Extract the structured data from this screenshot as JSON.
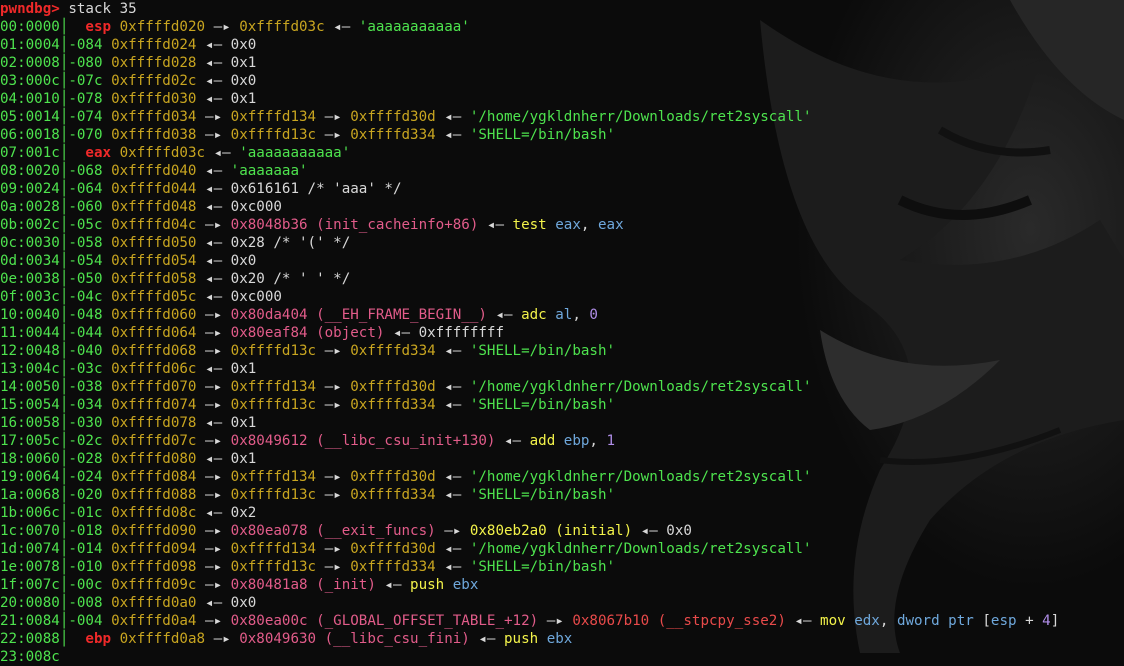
{
  "prompt": {
    "name": "pwndbg>",
    "command": " stack 35"
  },
  "colors": {
    "background": "#0b0b0b",
    "register": "#ef2929",
    "offset": "#4ee34e",
    "stack_address": "#c8a520",
    "code_address": "#e25c8a",
    "instruction": "#f3f34a",
    "operand": "#6fa8dc",
    "number": "#b08ee8"
  },
  "arrows": {
    "right": "—▸",
    "left": "◂—"
  },
  "rows": [
    {
      "idx": "00:0000",
      "reg": "esp",
      "off": "",
      "addr": "0xffffd020",
      "tail": [
        {
          "t": "ra",
          "v": "0xffffd03c",
          "c": "olive"
        },
        {
          "t": "la",
          "v": "'aaaaaaaaaaa'",
          "c": "green"
        }
      ]
    },
    {
      "idx": "01:0004",
      "reg": "",
      "off": "-084",
      "addr": "0xffffd024",
      "tail": [
        {
          "t": "la",
          "v": "0x0",
          "c": "white"
        }
      ]
    },
    {
      "idx": "02:0008",
      "reg": "",
      "off": "-080",
      "addr": "0xffffd028",
      "tail": [
        {
          "t": "la",
          "v": "0x1",
          "c": "white"
        }
      ]
    },
    {
      "idx": "03:000c",
      "reg": "",
      "off": "-07c",
      "addr": "0xffffd02c",
      "tail": [
        {
          "t": "la",
          "v": "0x0",
          "c": "white"
        }
      ]
    },
    {
      "idx": "04:0010",
      "reg": "",
      "off": "-078",
      "addr": "0xffffd030",
      "tail": [
        {
          "t": "la",
          "v": "0x1",
          "c": "white"
        }
      ]
    },
    {
      "idx": "05:0014",
      "reg": "",
      "off": "-074",
      "addr": "0xffffd034",
      "tail": [
        {
          "t": "ra",
          "v": "0xffffd134",
          "c": "olive"
        },
        {
          "t": "ra",
          "v": "0xffffd30d",
          "c": "olive"
        },
        {
          "t": "la",
          "v": "'/home/ygkldnherr/Downloads/ret2syscall'",
          "c": "green"
        }
      ]
    },
    {
      "idx": "06:0018",
      "reg": "",
      "off": "-070",
      "addr": "0xffffd038",
      "tail": [
        {
          "t": "ra",
          "v": "0xffffd13c",
          "c": "olive"
        },
        {
          "t": "ra",
          "v": "0xffffd334",
          "c": "olive"
        },
        {
          "t": "la",
          "v": "'SHELL=/bin/bash'",
          "c": "green"
        }
      ]
    },
    {
      "idx": "07:001c",
      "reg": "eax",
      "off": "",
      "addr": "0xffffd03c",
      "tail": [
        {
          "t": "la",
          "v": "'aaaaaaaaaaa'",
          "c": "green"
        }
      ]
    },
    {
      "idx": "08:0020",
      "reg": "",
      "off": "-068",
      "addr": "0xffffd040",
      "tail": [
        {
          "t": "la",
          "v": "'aaaaaaa'",
          "c": "green"
        }
      ]
    },
    {
      "idx": "09:0024",
      "reg": "",
      "off": "-064",
      "addr": "0xffffd044",
      "tail": [
        {
          "t": "la",
          "v": "0x616161 /* 'aaa' */",
          "c": "white"
        }
      ]
    },
    {
      "idx": "0a:0028",
      "reg": "",
      "off": "-060",
      "addr": "0xffffd048",
      "tail": [
        {
          "t": "la",
          "v": "0xc000",
          "c": "white"
        }
      ]
    },
    {
      "idx": "0b:002c",
      "reg": "",
      "off": "-05c",
      "addr": "0xffffd04c",
      "tail": [
        {
          "t": "ra",
          "v": "0x8048b36 (init_cacheinfo+86)",
          "c": "pink"
        },
        {
          "t": "la",
          "v": "",
          "c": "white",
          "asm": [
            [
              "test",
              "yellow"
            ],
            [
              " eax",
              "cyan"
            ],
            [
              ", ",
              "white"
            ],
            [
              "eax",
              "cyan"
            ]
          ]
        }
      ]
    },
    {
      "idx": "0c:0030",
      "reg": "",
      "off": "-058",
      "addr": "0xffffd050",
      "tail": [
        {
          "t": "la",
          "v": "0x28 /* '(' */",
          "c": "white"
        }
      ]
    },
    {
      "idx": "0d:0034",
      "reg": "",
      "off": "-054",
      "addr": "0xffffd054",
      "tail": [
        {
          "t": "la",
          "v": "0x0",
          "c": "white"
        }
      ]
    },
    {
      "idx": "0e:0038",
      "reg": "",
      "off": "-050",
      "addr": "0xffffd058",
      "tail": [
        {
          "t": "la",
          "v": "0x20 /* ' ' */",
          "c": "white"
        }
      ]
    },
    {
      "idx": "0f:003c",
      "reg": "",
      "off": "-04c",
      "addr": "0xffffd05c",
      "tail": [
        {
          "t": "la",
          "v": "0xc000",
          "c": "white"
        }
      ]
    },
    {
      "idx": "10:0040",
      "reg": "",
      "off": "-048",
      "addr": "0xffffd060",
      "tail": [
        {
          "t": "ra",
          "v": "0x80da404 (__EH_FRAME_BEGIN__)",
          "c": "pink"
        },
        {
          "t": "la",
          "v": "",
          "c": "white",
          "asm": [
            [
              "adc",
              "yellow"
            ],
            [
              " al",
              "cyan"
            ],
            [
              ", ",
              "white"
            ],
            [
              "0",
              "purple"
            ]
          ]
        }
      ]
    },
    {
      "idx": "11:0044",
      "reg": "",
      "off": "-044",
      "addr": "0xffffd064",
      "tail": [
        {
          "t": "ra",
          "v": "0x80eaf84 (object)",
          "c": "pink"
        },
        {
          "t": "la",
          "v": "0xffffffff",
          "c": "white"
        }
      ]
    },
    {
      "idx": "12:0048",
      "reg": "",
      "off": "-040",
      "addr": "0xffffd068",
      "tail": [
        {
          "t": "ra",
          "v": "0xffffd13c",
          "c": "olive"
        },
        {
          "t": "ra",
          "v": "0xffffd334",
          "c": "olive"
        },
        {
          "t": "la",
          "v": "'SHELL=/bin/bash'",
          "c": "green"
        }
      ]
    },
    {
      "idx": "13:004c",
      "reg": "",
      "off": "-03c",
      "addr": "0xffffd06c",
      "tail": [
        {
          "t": "la",
          "v": "0x1",
          "c": "white"
        }
      ]
    },
    {
      "idx": "14:0050",
      "reg": "",
      "off": "-038",
      "addr": "0xffffd070",
      "tail": [
        {
          "t": "ra",
          "v": "0xffffd134",
          "c": "olive"
        },
        {
          "t": "ra",
          "v": "0xffffd30d",
          "c": "olive"
        },
        {
          "t": "la",
          "v": "'/home/ygkldnherr/Downloads/ret2syscall'",
          "c": "green"
        }
      ]
    },
    {
      "idx": "15:0054",
      "reg": "",
      "off": "-034",
      "addr": "0xffffd074",
      "tail": [
        {
          "t": "ra",
          "v": "0xffffd13c",
          "c": "olive"
        },
        {
          "t": "ra",
          "v": "0xffffd334",
          "c": "olive"
        },
        {
          "t": "la",
          "v": "'SHELL=/bin/bash'",
          "c": "green"
        }
      ]
    },
    {
      "idx": "16:0058",
      "reg": "",
      "off": "-030",
      "addr": "0xffffd078",
      "tail": [
        {
          "t": "la",
          "v": "0x1",
          "c": "white"
        }
      ]
    },
    {
      "idx": "17:005c",
      "reg": "",
      "off": "-02c",
      "addr": "0xffffd07c",
      "tail": [
        {
          "t": "ra",
          "v": "0x8049612 (__libc_csu_init+130)",
          "c": "pink"
        },
        {
          "t": "la",
          "v": "",
          "c": "white",
          "asm": [
            [
              "add",
              "yellow"
            ],
            [
              " ebp",
              "cyan"
            ],
            [
              ", ",
              "white"
            ],
            [
              "1",
              "purple"
            ]
          ]
        }
      ]
    },
    {
      "idx": "18:0060",
      "reg": "",
      "off": "-028",
      "addr": "0xffffd080",
      "tail": [
        {
          "t": "la",
          "v": "0x1",
          "c": "white"
        }
      ]
    },
    {
      "idx": "19:0064",
      "reg": "",
      "off": "-024",
      "addr": "0xffffd084",
      "tail": [
        {
          "t": "ra",
          "v": "0xffffd134",
          "c": "olive"
        },
        {
          "t": "ra",
          "v": "0xffffd30d",
          "c": "olive"
        },
        {
          "t": "la",
          "v": "'/home/ygkldnherr/Downloads/ret2syscall'",
          "c": "green"
        }
      ]
    },
    {
      "idx": "1a:0068",
      "reg": "",
      "off": "-020",
      "addr": "0xffffd088",
      "tail": [
        {
          "t": "ra",
          "v": "0xffffd13c",
          "c": "olive"
        },
        {
          "t": "ra",
          "v": "0xffffd334",
          "c": "olive"
        },
        {
          "t": "la",
          "v": "'SHELL=/bin/bash'",
          "c": "green"
        }
      ]
    },
    {
      "idx": "1b:006c",
      "reg": "",
      "off": "-01c",
      "addr": "0xffffd08c",
      "tail": [
        {
          "t": "la",
          "v": "0x2",
          "c": "white"
        }
      ]
    },
    {
      "idx": "1c:0070",
      "reg": "",
      "off": "-018",
      "addr": "0xffffd090",
      "tail": [
        {
          "t": "ra",
          "v": "0x80ea078 (__exit_funcs)",
          "c": "pink"
        },
        {
          "t": "ra",
          "v": "0x80eb2a0 (initial)",
          "c": "yellow"
        },
        {
          "t": "la",
          "v": "0x0",
          "c": "white"
        }
      ]
    },
    {
      "idx": "1d:0074",
      "reg": "",
      "off": "-014",
      "addr": "0xffffd094",
      "tail": [
        {
          "t": "ra",
          "v": "0xffffd134",
          "c": "olive"
        },
        {
          "t": "ra",
          "v": "0xffffd30d",
          "c": "olive"
        },
        {
          "t": "la",
          "v": "'/home/ygkldnherr/Downloads/ret2syscall'",
          "c": "green"
        }
      ]
    },
    {
      "idx": "1e:0078",
      "reg": "",
      "off": "-010",
      "addr": "0xffffd098",
      "tail": [
        {
          "t": "ra",
          "v": "0xffffd13c",
          "c": "olive"
        },
        {
          "t": "ra",
          "v": "0xffffd334",
          "c": "olive"
        },
        {
          "t": "la",
          "v": "'SHELL=/bin/bash'",
          "c": "green"
        }
      ]
    },
    {
      "idx": "1f:007c",
      "reg": "",
      "off": "-00c",
      "addr": "0xffffd09c",
      "tail": [
        {
          "t": "ra",
          "v": "0x80481a8 (_init)",
          "c": "pink"
        },
        {
          "t": "la",
          "v": "",
          "c": "white",
          "asm": [
            [
              "push",
              "yellow"
            ],
            [
              " ebx",
              "cyan"
            ]
          ]
        }
      ]
    },
    {
      "idx": "20:0080",
      "reg": "",
      "off": "-008",
      "addr": "0xffffd0a0",
      "tail": [
        {
          "t": "la",
          "v": "0x0",
          "c": "white"
        }
      ]
    },
    {
      "idx": "21:0084",
      "reg": "",
      "off": "-004",
      "addr": "0xffffd0a4",
      "tail": [
        {
          "t": "ra",
          "v": "0x80ea00c (_GLOBAL_OFFSET_TABLE_+12)",
          "c": "pink"
        },
        {
          "t": "ra",
          "v": "0x8067b10 (__stpcpy_sse2)",
          "c": "rred"
        },
        {
          "t": "la",
          "v": "",
          "c": "white",
          "asm": [
            [
              "mov",
              "yellow"
            ],
            [
              " edx",
              "cyan"
            ],
            [
              ", ",
              "white"
            ],
            [
              "dword ptr",
              "cyan"
            ],
            [
              " [",
              "white"
            ],
            [
              "esp",
              "cyan"
            ],
            [
              " + ",
              "white"
            ],
            [
              "4",
              "purple"
            ],
            [
              "]",
              "white"
            ]
          ]
        }
      ]
    },
    {
      "idx": "22:0088",
      "reg": "ebp",
      "off": "",
      "addr": "0xffffd0a8",
      "tail": [
        {
          "t": "ra",
          "v": "0x8049630 (__libc_csu_fini)",
          "c": "pink"
        },
        {
          "t": "la",
          "v": "",
          "c": "white",
          "asm": [
            [
              "push",
              "yellow"
            ],
            [
              " ebx",
              "cyan"
            ]
          ]
        }
      ]
    }
  ],
  "partial_line": "23:008c"
}
